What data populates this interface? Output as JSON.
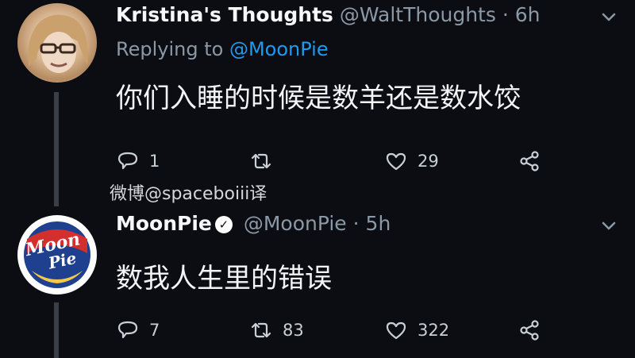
{
  "tweets": [
    {
      "display_name": "Kristina's Thoughts",
      "handle": "@WaltThoughts",
      "separator": "·",
      "time": "6h",
      "replying_prefix": "Replying to",
      "replying_to": "@MoonPie",
      "text": "你们入睡的时候是数羊还是数水饺",
      "replies": "1",
      "retweets": "",
      "likes": "29"
    },
    {
      "display_name": "MoonPie",
      "verified_mark": "✓",
      "handle": "@MoonPie",
      "separator": "·",
      "time": "5h",
      "logo_line1": "Moon",
      "logo_line2": "Pie",
      "text": "数我人生里的错误",
      "replies": "7",
      "retweets": "83",
      "likes": "322"
    }
  ],
  "watermark": "微博@spaceboiii译",
  "colors": {
    "background": "#0b0d12",
    "secondary_text": "#8b98a5",
    "mention": "#1d9bf0",
    "icon": "#c9d0d6"
  },
  "icons": [
    "avatar-photo",
    "moonpie-logo",
    "verified-icon",
    "chevron-down-icon",
    "reply-icon",
    "retweet-icon",
    "like-icon",
    "share-icon"
  ]
}
